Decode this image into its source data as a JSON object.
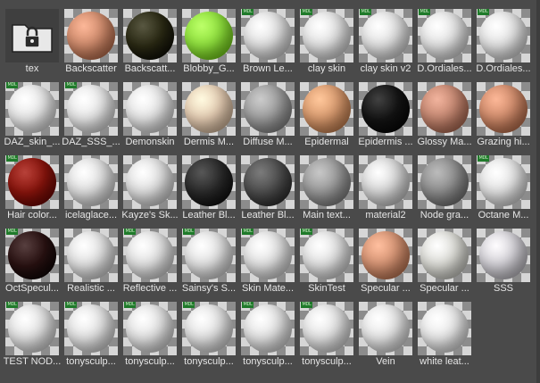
{
  "badge_text": "MDL",
  "items": [
    {
      "label": "tex",
      "type": "folder",
      "icon": "folder-lock-icon"
    },
    {
      "label": "Backscatter",
      "color": "#cf8a6b",
      "badge": false
    },
    {
      "label": "Backscatt...",
      "color": "#2b2a14",
      "badge": false
    },
    {
      "label": "Blobby_G...",
      "color": "#8fe23c",
      "badge": false
    },
    {
      "label": "Brown Le...",
      "color": "#e1e1e1",
      "badge": true
    },
    {
      "label": "clay skin",
      "color": "#e3e3e3",
      "badge": true
    },
    {
      "label": "clay skin v2",
      "color": "#e3e3e3",
      "badge": true
    },
    {
      "label": "D.Ordiales...",
      "color": "#e4e4e4",
      "badge": true
    },
    {
      "label": "D.Ordiales...",
      "color": "#e4e4e4",
      "badge": true
    },
    {
      "label": "DAZ_skin_...",
      "color": "#e8e8e8",
      "badge": true
    },
    {
      "label": "DAZ_SSS_...",
      "color": "#e8e8e8",
      "badge": true
    },
    {
      "label": "Demonskin",
      "color": "#e6e6e6",
      "badge": false
    },
    {
      "label": "Dermis M...",
      "color": "#e6cdb3",
      "badge": false
    },
    {
      "label": "Diffuse M...",
      "color": "#9e9e9e",
      "badge": false
    },
    {
      "label": "Epidermal",
      "color": "#d99a6e",
      "badge": false
    },
    {
      "label": "Epidermis ...",
      "color": "#141414",
      "badge": false
    },
    {
      "label": "Glossy Ma...",
      "color": "#c48670",
      "badge": false
    },
    {
      "label": "Grazing hi...",
      "color": "#cf8a6a",
      "badge": false
    },
    {
      "label": "Hair color...",
      "color": "#8a140c",
      "badge": true
    },
    {
      "label": "icelaglace...",
      "color": "#e1e1e1",
      "badge": false
    },
    {
      "label": "Kayze's Sk...",
      "color": "#e1e1e1",
      "badge": false
    },
    {
      "label": "Leather Bl...",
      "color": "#2a2a2a",
      "badge": false
    },
    {
      "label": "Leather Bl...",
      "color": "#4e4e4e",
      "badge": false
    },
    {
      "label": "Main text...",
      "color": "#9a9a9a",
      "badge": false
    },
    {
      "label": "material2",
      "color": "#d8d8d8",
      "badge": false
    },
    {
      "label": "Node gra...",
      "color": "#8e8e8e",
      "badge": false
    },
    {
      "label": "Octane M...",
      "color": "#e4e4e4",
      "badge": true
    },
    {
      "label": "OctSpecul...",
      "color": "#2a1212",
      "badge": true
    },
    {
      "label": "Realistic ...",
      "color": "#e2e2e2",
      "badge": false
    },
    {
      "label": "Reflective ...",
      "color": "#e2e2e2",
      "badge": true
    },
    {
      "label": "Sainsy's S...",
      "color": "#e2e2e2",
      "badge": true
    },
    {
      "label": "Skin Mate...",
      "color": "#e2e2e2",
      "badge": true
    },
    {
      "label": "SkinTest",
      "color": "#e2e2e2",
      "badge": true
    },
    {
      "label": "Specular ...",
      "color": "#d49272",
      "badge": false
    },
    {
      "label": "Specular ...",
      "color": "#dcdcd6",
      "badge": false
    },
    {
      "label": "SSS",
      "color": "#d2d0d6",
      "badge": false
    },
    {
      "label": "TEST NOD...",
      "color": "#e3e3e3",
      "badge": true
    },
    {
      "label": "tonysculp...",
      "color": "#e3e3e3",
      "badge": true
    },
    {
      "label": "tonysculp...",
      "color": "#e3e3e3",
      "badge": true
    },
    {
      "label": "tonysculp...",
      "color": "#e3e3e3",
      "badge": true
    },
    {
      "label": "tonysculp...",
      "color": "#e3e3e3",
      "badge": true
    },
    {
      "label": "tonysculp...",
      "color": "#e3e3e3",
      "badge": true
    },
    {
      "label": "Vein",
      "color": "#e6e6e6",
      "badge": false
    },
    {
      "label": "white leat...",
      "color": "#e9e9e9",
      "badge": false
    }
  ]
}
